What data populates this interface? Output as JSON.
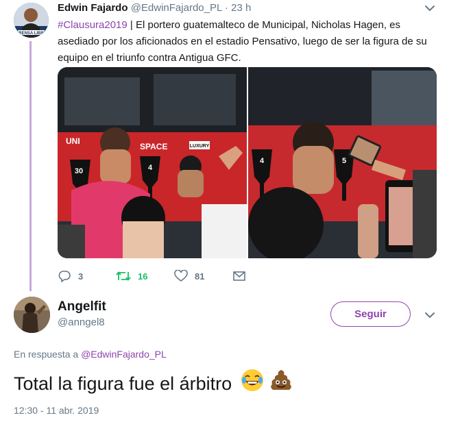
{
  "tweet1": {
    "author_name": "Edwin Fajardo",
    "author_handle": "@EdwinFajardo_PL",
    "separator": " · ",
    "time": "23 h",
    "hashtag": "#Clausura2019",
    "text": " | El portero guatemalteco de Municipal, Nicholas Hagen, es asediado por los aficionados en el estadio Pensativo, luego de ser la figura de su equipo en el triunfo contra Antigua GFC.",
    "avatar_caption": "PRENSA LIBRE",
    "actions": {
      "reply_count": "3",
      "retweet_count": "16",
      "like_count": "81"
    },
    "photo_text": {
      "banner_left": "UNI",
      "banner_mid": "SPACE",
      "banner_luxury": "LUXURY",
      "trophy_30": "30",
      "trophy_4": "4",
      "trophy_4b": "4",
      "trophy_5": "5"
    }
  },
  "tweet2": {
    "author_name": "Angelfit",
    "author_handle": "@anngel8",
    "follow_label": "Seguir",
    "reply_prefix": "En respuesta a ",
    "reply_mention": "@EdwinFajardo_PL",
    "text": "Total la figura fue el árbitro",
    "emoji1": "😂",
    "emoji2": "💩",
    "timestamp": "12:30 - 11 abr. 2019"
  },
  "colors": {
    "accent": "#8e44ad",
    "retweet": "#17bf63",
    "muted": "#657786",
    "text": "#14171a"
  },
  "icons": [
    "chevron-down-icon",
    "reply-icon",
    "retweet-icon",
    "like-icon",
    "message-icon"
  ]
}
